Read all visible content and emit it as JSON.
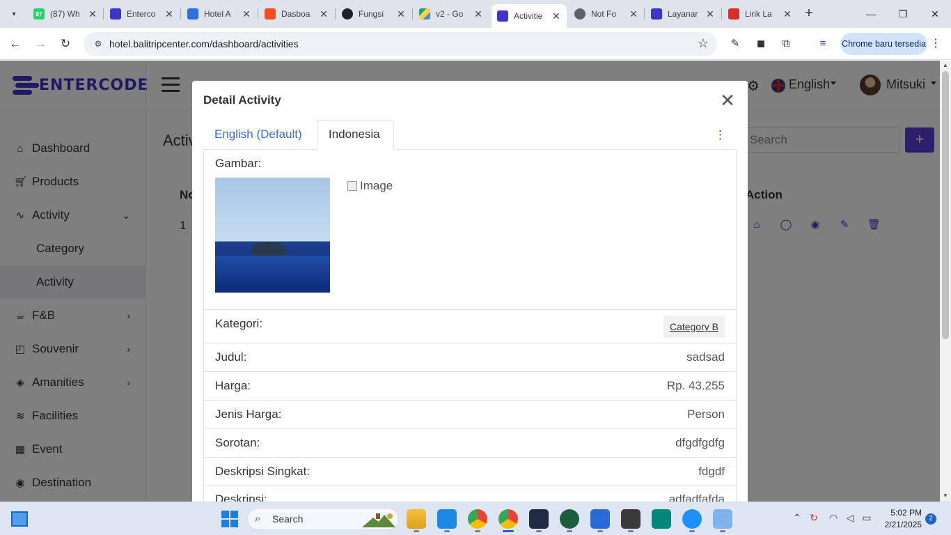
{
  "browser": {
    "tabs": [
      {
        "title": "(87) Wh",
        "favicon": "whatsapp-icon",
        "color": "#25d366"
      },
      {
        "title": "Enterco",
        "favicon": "entercode-icon",
        "color": "#3f35c5"
      },
      {
        "title": "Hotel A",
        "favicon": "hotel-app-icon",
        "color": "#2f6fe0"
      },
      {
        "title": "Dasboa",
        "favicon": "figma-icon",
        "color": "#f24e1e"
      },
      {
        "title": "Fungsi",
        "favicon": "openai-icon",
        "color": "#202124"
      },
      {
        "title": "v2 - Go",
        "favicon": "google-drive-icon",
        "color": "#1fa463"
      },
      {
        "title": "Activitie",
        "favicon": "entercode-icon",
        "color": "#3f35c5"
      },
      {
        "title": "Not Fo",
        "favicon": "globe-icon",
        "color": "#5f6368"
      },
      {
        "title": "Layanar",
        "favicon": "entercode-icon",
        "color": "#3f35c5"
      },
      {
        "title": "Lirik La",
        "favicon": "lyrics-site-icon",
        "color": "#d93025"
      }
    ],
    "url": "hotel.balitripcenter.com/dashboard/activities",
    "update_label": "Chrome baru tersedia"
  },
  "app": {
    "logo_text": "ENTERCODE",
    "language": "English",
    "user_name": "Mitsuki",
    "page_title": "Activ",
    "search_placeholder": "Search",
    "add_label": "+",
    "table": {
      "col_no": "No",
      "col_action": "Action",
      "row_no": "1"
    }
  },
  "sidebar": {
    "items": [
      {
        "label": "Dashboard",
        "icon": "home-icon"
      },
      {
        "label": "Products",
        "icon": "cart-icon"
      },
      {
        "label": "Activity",
        "icon": "activity-icon"
      },
      {
        "label": "Category",
        "icon": ""
      },
      {
        "label": "Activity",
        "icon": ""
      },
      {
        "label": "F&B",
        "icon": "coffee-icon"
      },
      {
        "label": "Souvenir",
        "icon": "bag-icon"
      },
      {
        "label": "Amanities",
        "icon": "box-icon"
      },
      {
        "label": "Facilities",
        "icon": "layers-icon"
      },
      {
        "label": "Event",
        "icon": "calendar-icon"
      },
      {
        "label": "Destination",
        "icon": "map-pin-icon"
      }
    ]
  },
  "modal": {
    "title": "Detail Activity",
    "tab_default": "English (Default)",
    "tab_active": "Indonesia",
    "gallery_label": "Gambar:",
    "broken_image_alt": "Image",
    "category_label": "Kategori:",
    "category_value": "Category B",
    "fields": [
      {
        "label": "Judul:",
        "value": "sadsad"
      },
      {
        "label": "Harga:",
        "value": "Rp. 43.255"
      },
      {
        "label": "Jenis Harga:",
        "value": "Person"
      },
      {
        "label": "Sorotan:",
        "value": "dfgdfgdfg"
      },
      {
        "label": "Deskripsi Singkat:",
        "value": "fdgdf"
      },
      {
        "label": "Deskripsi:",
        "value": "adfadfafda"
      }
    ]
  },
  "taskbar": {
    "search_label": "Search",
    "time": "5:02 PM",
    "date": "2/21/2025",
    "notifications": "2"
  },
  "colors": {
    "brand": "#3f35c5",
    "link": "#3d6fd1",
    "accent_button": "#5b3fd6"
  }
}
